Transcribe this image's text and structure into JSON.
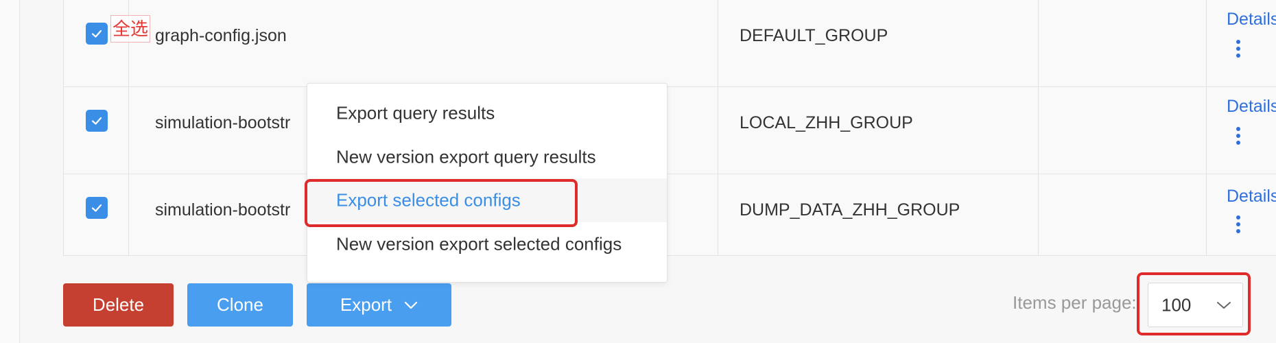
{
  "table": {
    "rows": [
      {
        "checked": true,
        "data_id": "graph-config.json",
        "group": "DEFAULT_GROUP",
        "action": "Details"
      },
      {
        "checked": true,
        "data_id": "simulation-bootstr",
        "group": "LOCAL_ZHH_GROUP",
        "action": "Details"
      },
      {
        "checked": true,
        "data_id": "simulation-bootstr",
        "group": "DUMP_DATA_ZHH_GROUP",
        "action": "Details"
      }
    ]
  },
  "annotation": {
    "select_all_tag": "全选"
  },
  "export_menu": {
    "items": [
      {
        "label": "Export query results",
        "active": false
      },
      {
        "label": "New version export query results",
        "active": false
      },
      {
        "label": "Export selected configs",
        "active": true
      },
      {
        "label": "New version export selected configs",
        "active": false
      }
    ]
  },
  "toolbar": {
    "delete_label": "Delete",
    "clone_label": "Clone",
    "export_label": "Export"
  },
  "pagination": {
    "items_per_page_label": "Items per page:",
    "page_size": "100"
  },
  "colors": {
    "primary": "#4a9ef0",
    "danger": "#c54030",
    "link": "#2f6fdc",
    "highlight": "#e02b2b"
  },
  "icons": [
    "check-icon",
    "more-vertical-icon",
    "chevron-down-icon"
  ]
}
